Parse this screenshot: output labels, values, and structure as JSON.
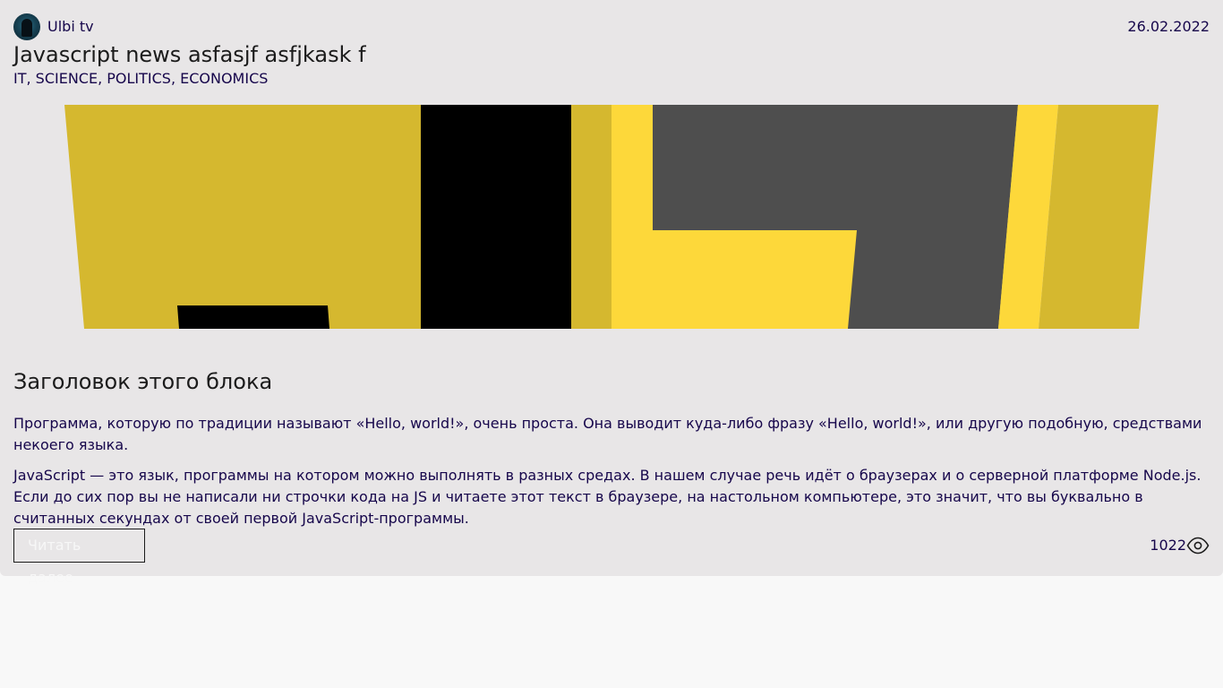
{
  "article": {
    "author": "Ulbi tv",
    "date": "26.02.2022",
    "title": "Javascript news asfasjf asfjkask f",
    "tags": "IT, SCIENCE, POLITICS, ECONOMICS",
    "block_title": "Заголовок этого блока",
    "paragraphs": [
      "Программа, которую по традиции называют «Hello, world!», очень проста. Она выводит куда-либо фразу «Hello, world!», или другую подобную, средствами некоего языка.",
      "JavaScript — это язык, программы на котором можно выполнять в разных средах. В нашем случае речь идёт о браузерах и о серверной платформе Node.js. Если до сих пор вы не написали ни строчки кода на JS и читаете этот текст в браузере, на настольном компьютере, это значит, что вы буквально в считанных секундах от своей первой JavaScript-программы."
    ],
    "read_more_label": "Читать далее",
    "views": "1022"
  },
  "icons": {
    "avatar": "avatar-image",
    "views": "eye-icon"
  },
  "colors": {
    "card_background": "#e8e6e7",
    "page_background": "#f8f8f8",
    "text_primary": "#16064b",
    "js_yellow_dark": "#d5b82f",
    "js_yellow_light": "#fdd83a",
    "js_black": "#000000",
    "js_gray": "#4e4e4e"
  }
}
